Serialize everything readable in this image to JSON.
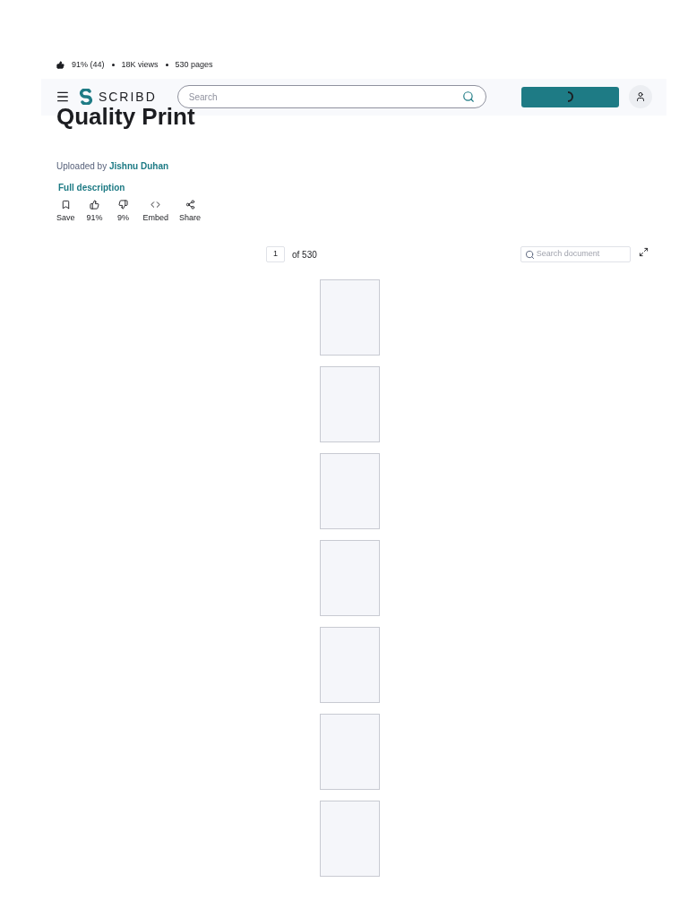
{
  "stats": {
    "rating": "91% (44)",
    "views": "18K views",
    "pages": "530 pages"
  },
  "header": {
    "logo": "SCRIBD",
    "search": {
      "placeholder": "Search"
    },
    "upload_button": {
      "loading": true
    }
  },
  "title": "Quality Print",
  "uploader": {
    "prefix": "Uploaded by",
    "name": "Jishnu Duhan"
  },
  "description_link": "Full description",
  "actions": [
    {
      "kind": "save",
      "label": "Save"
    },
    {
      "kind": "like",
      "label": "91%"
    },
    {
      "kind": "dislike",
      "label": "9%"
    },
    {
      "kind": "embed",
      "label": "Embed"
    },
    {
      "kind": "share",
      "label": "Share"
    }
  ],
  "viewer": {
    "page_field": "1",
    "page_total": "of 530",
    "search": {
      "placeholder": "Search document"
    }
  },
  "document_pages": [
    {
      "kind": "page"
    },
    {
      "kind": "page"
    },
    {
      "kind": "page"
    },
    {
      "kind": "page"
    },
    {
      "kind": "page"
    },
    {
      "kind": "page"
    },
    {
      "kind": "page"
    }
  ]
}
